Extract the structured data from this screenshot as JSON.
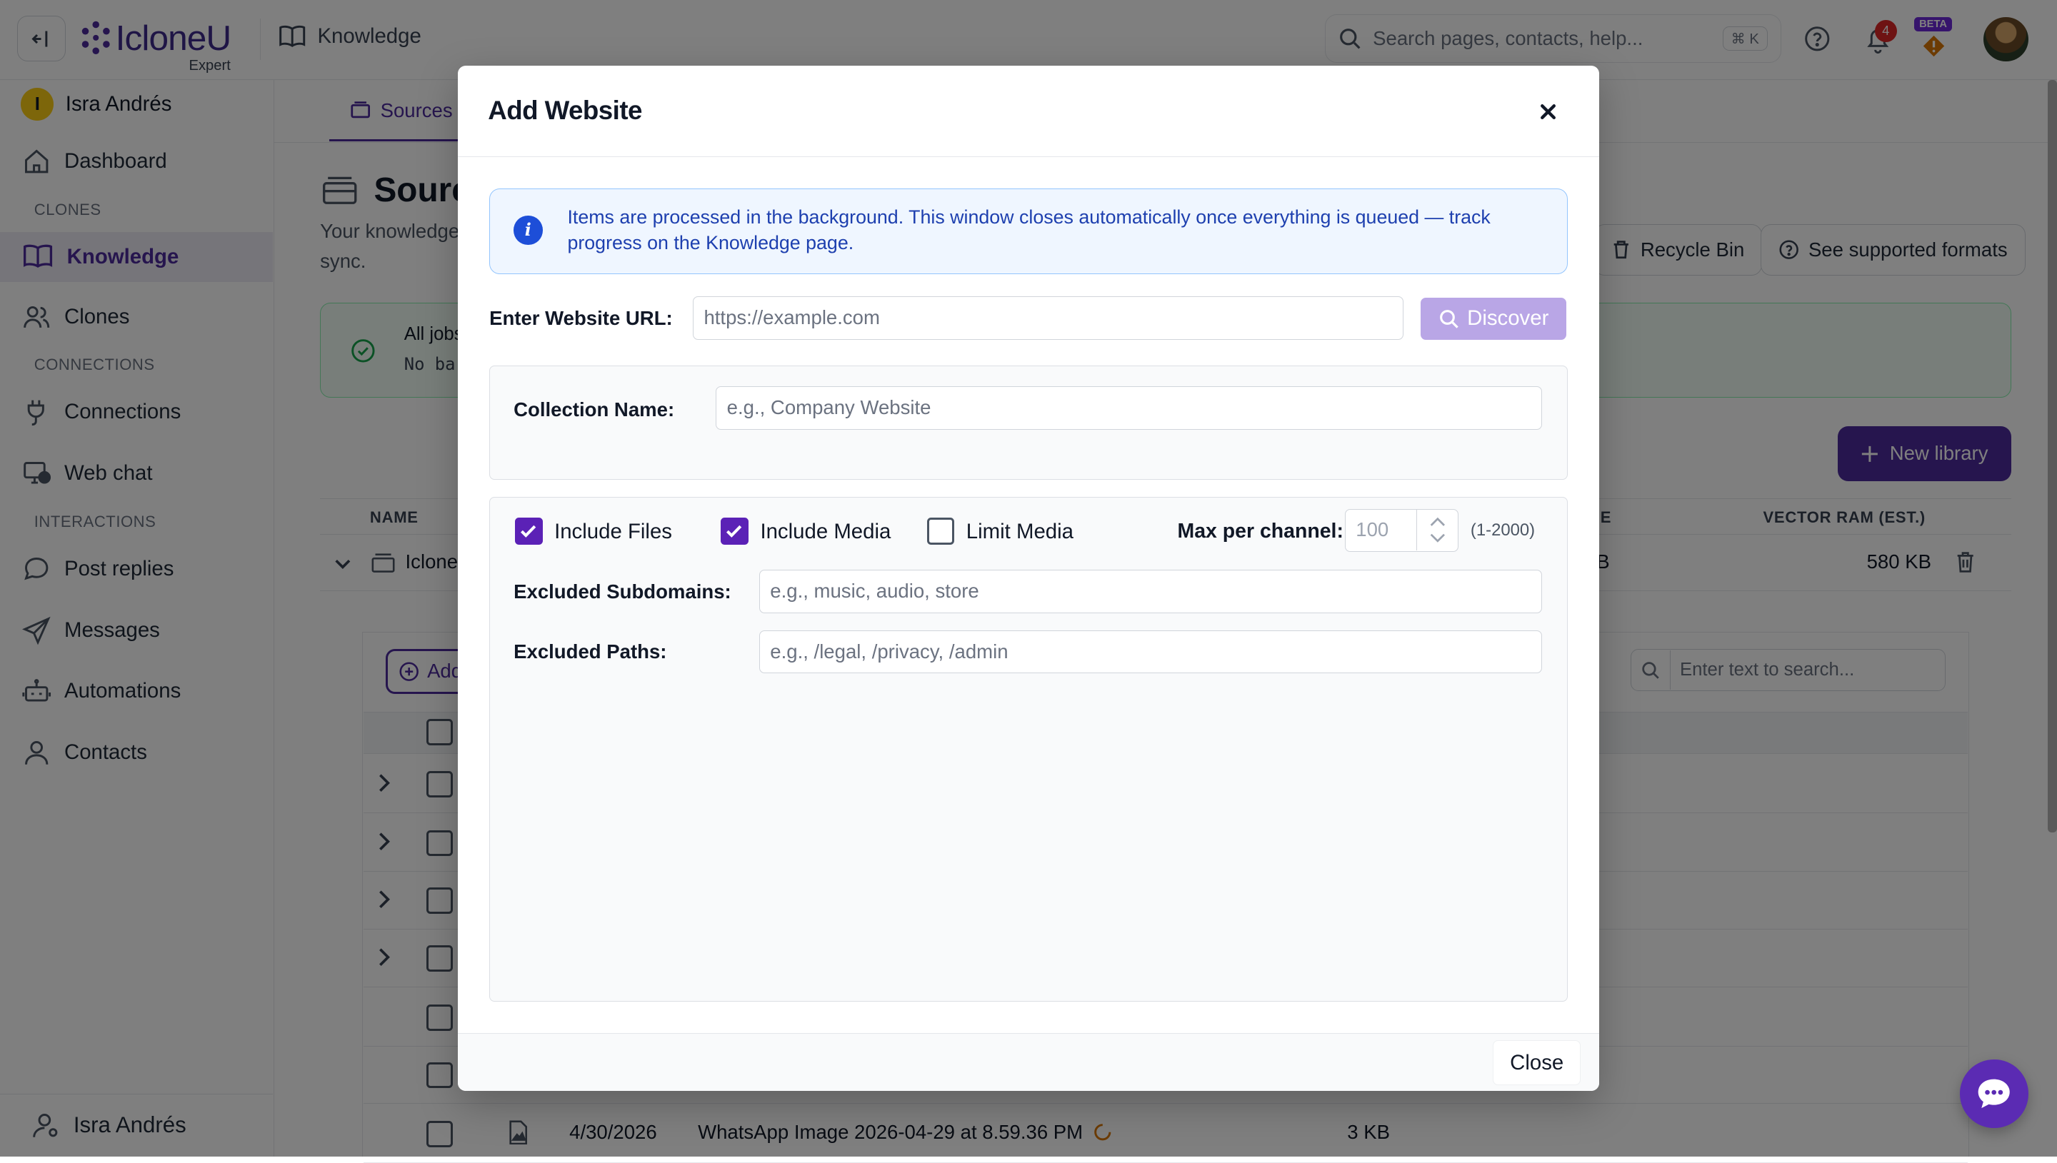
{
  "app": {
    "brand": "IcloneU",
    "brand_sub": "Expert",
    "breadcrumb": "Knowledge"
  },
  "topbar": {
    "search_placeholder": "Search pages, contacts, help...",
    "search_shortcut": "⌘ K",
    "notification_count": "4",
    "beta_label": "BETA"
  },
  "sidebar": {
    "user_initial": "I",
    "user_name": "Isra Andrés",
    "items": [
      {
        "label": "Dashboard",
        "icon": "home-icon"
      },
      {
        "label": "Knowledge",
        "icon": "book-icon",
        "active": true
      },
      {
        "label": "Clones",
        "icon": "users-icon"
      },
      {
        "label": "Connections",
        "icon": "plug-icon"
      },
      {
        "label": "Web chat",
        "icon": "monitor-chat-icon"
      },
      {
        "label": "Post replies",
        "icon": "chat-bubble-icon"
      },
      {
        "label": "Messages",
        "icon": "send-icon"
      },
      {
        "label": "Automations",
        "icon": "robot-icon"
      },
      {
        "label": "Contacts",
        "icon": "user-icon"
      }
    ],
    "sections": {
      "clones": "CLONES",
      "connections": "CONNECTIONS",
      "interactions": "INTERACTIONS"
    },
    "bottom_user": "Isra Andrés"
  },
  "main": {
    "tab_sources": "Sources",
    "title": "Sources",
    "desc": "Your knowledge sync.",
    "recycle_bin": "Recycle Bin",
    "supported_formats": "See supported formats",
    "status_title": "All jobs",
    "status_detail": "No ba",
    "new_library": "New library",
    "table": {
      "col_name": "NAME",
      "col_size_partial": "E",
      "col_vector": "VECTOR RAM (EST.)",
      "row_name": "Iclone",
      "row_size_partial": "B",
      "row_vector": "580 KB"
    },
    "add_button": "Add",
    "inner_search_placeholder": "Enter text to search...",
    "last_row": {
      "date": "4/30/2026",
      "name": "WhatsApp Image 2026-04-29 at 8.59.36 PM",
      "size": "3 KB"
    }
  },
  "modal": {
    "title": "Add Website",
    "info": "Items are processed in the background. This window closes automatically once everything is queued — track progress on the Knowledge page.",
    "url_label": "Enter Website URL:",
    "url_placeholder": "https://example.com",
    "url_value": "",
    "discover_label": "Discover",
    "collection_label": "Collection Name:",
    "collection_placeholder": "e.g., Company Website",
    "include_files": {
      "label": "Include Files",
      "checked": true
    },
    "include_media": {
      "label": "Include Media",
      "checked": true
    },
    "limit_media": {
      "label": "Limit Media",
      "checked": false
    },
    "max_label": "Max per channel:",
    "max_value": "100",
    "max_range": "(1-2000)",
    "excluded_subdomains_label": "Excluded Subdomains:",
    "excluded_subdomains_placeholder": "e.g., music, audio, store",
    "excluded_paths_label": "Excluded Paths:",
    "excluded_paths_placeholder": "e.g., /legal, /privacy, /admin",
    "close_label": "Close"
  },
  "colors": {
    "brand": "#4c2a9c",
    "checkbox": "#5b21b6",
    "info_text": "#1e40af",
    "discover_disabled": "#b9a6e6"
  }
}
